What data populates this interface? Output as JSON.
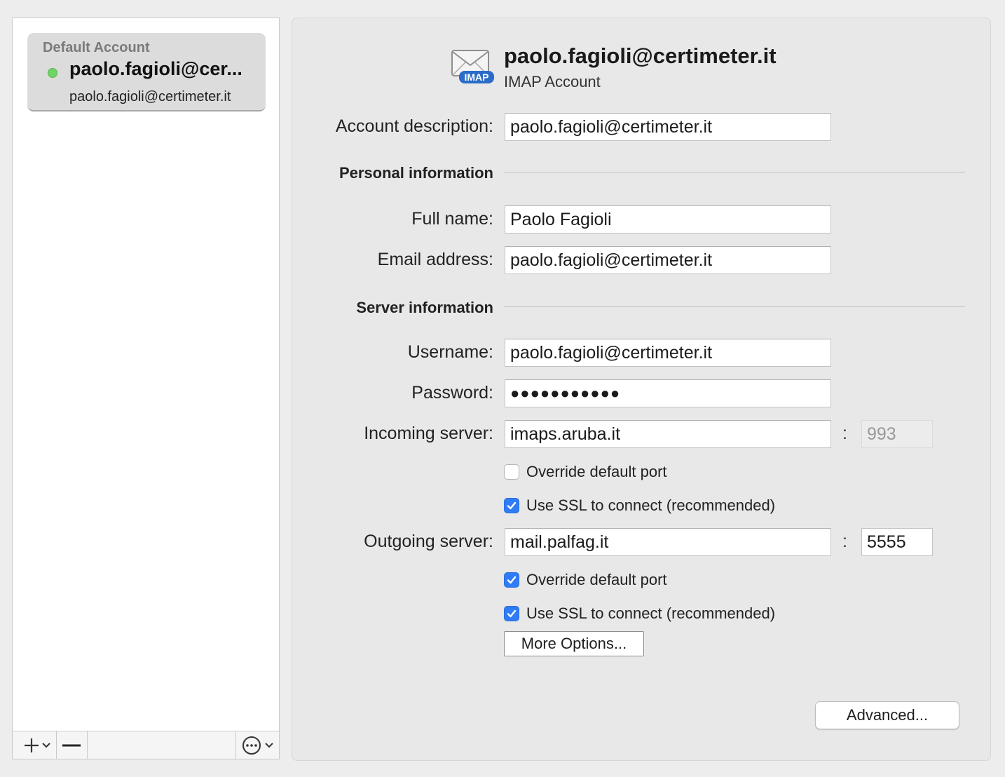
{
  "sidebar": {
    "default_label": "Default Account",
    "account_name": "paolo.fagioli@cer...",
    "account_email": "paolo.fagioli@certimeter.it",
    "status_color": "#6fd366",
    "toolbar": {
      "add_icon": "plus-icon",
      "remove_icon": "minus-icon",
      "more_icon": "ellipsis-circle-icon"
    }
  },
  "header": {
    "icon": "imap-envelope-icon",
    "icon_badge": "IMAP",
    "title": "paolo.fagioli@certimeter.it",
    "subtitle": "IMAP Account"
  },
  "form": {
    "account_description": {
      "label": "Account description:",
      "value": "paolo.fagioli@certimeter.it"
    },
    "personal_section": "Personal information",
    "full_name": {
      "label": "Full name:",
      "value": "Paolo Fagioli"
    },
    "email_address": {
      "label": "Email address:",
      "value": "paolo.fagioli@certimeter.it"
    },
    "server_section": "Server information",
    "username": {
      "label": "Username:",
      "value": "paolo.fagioli@certimeter.it"
    },
    "password": {
      "label": "Password:",
      "value": "●●●●●●●●●●●"
    },
    "incoming": {
      "label": "Incoming server:",
      "value": "imaps.aruba.it",
      "colon": ":",
      "port": "993",
      "port_disabled": true,
      "override_label": "Override default port",
      "override_checked": false,
      "ssl_label": "Use SSL to connect (recommended)",
      "ssl_checked": true
    },
    "outgoing": {
      "label": "Outgoing server:",
      "value": "mail.palfag.it",
      "colon": ":",
      "port": "5555",
      "port_disabled": false,
      "override_label": "Override default port",
      "override_checked": true,
      "ssl_label": "Use SSL to connect (recommended)",
      "ssl_checked": true
    }
  },
  "buttons": {
    "more_options": "More Options...",
    "advanced": "Advanced..."
  },
  "colors": {
    "accent": "#2f7cf6",
    "pane_bg": "#e8e8e8",
    "status_green": "#6fd366"
  }
}
